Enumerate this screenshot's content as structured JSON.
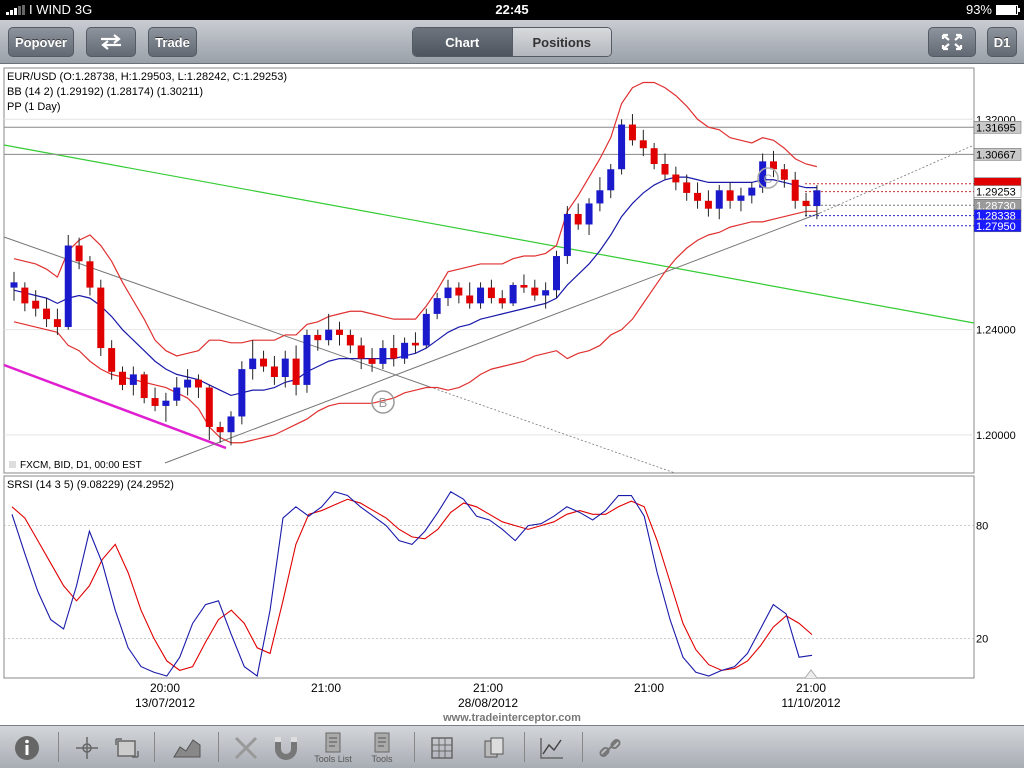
{
  "status": {
    "carrier": "I WIND",
    "network": "3G",
    "time": "22:45",
    "battery": "93%",
    "battery_level": 0.93
  },
  "toolbar": {
    "popover_label": "Popover",
    "trade_label": "Trade",
    "chart_tab": "Chart",
    "positions_tab": "Positions",
    "timeframe_label": "D1",
    "swap_icon": "swap-arrows-icon",
    "fullscreen_icon": "fullscreen-icon"
  },
  "main_chart": {
    "symbol_info": "EUR/USD (O:1.28738, H:1.29503, L:1.28242, C:1.29253)",
    "bb_info": "BB (14 2) (1.29192) (1.28174) (1.30211)",
    "pp_info": "PP (1 Day)",
    "source_info": "FXCM, BID, D1, 00:00 EST",
    "y_ticks": [
      "1.32000",
      "1.24000",
      "1.20000"
    ],
    "y_tick_values": [
      1.32,
      1.24,
      1.2
    ],
    "price_tags": [
      {
        "label": "1.31695",
        "value": 1.31695,
        "bg": "#c8c8c8",
        "fg": "#000000"
      },
      {
        "label": "1.30667",
        "value": 1.30667,
        "bg": "#c8c8c8",
        "fg": "#000000"
      },
      {
        "label": "",
        "value": 1.2955,
        "bg": "#e00000",
        "fg": "#ffffff"
      },
      {
        "label": "1.29253",
        "value": 1.29253,
        "bg": "#ffffff",
        "fg": "#000000"
      },
      {
        "label": "1.28730",
        "value": 1.2873,
        "bg": "#9a9a9a",
        "fg": "#ffffff"
      },
      {
        "label": "1.28338",
        "value": 1.28338,
        "bg": "#1a1aff",
        "fg": "#ffffff"
      },
      {
        "label": "1.27950",
        "value": 1.2795,
        "bg": "#1a1aff",
        "fg": "#ffffff"
      }
    ],
    "marker_b": "B",
    "marker_c": "C"
  },
  "sub_chart": {
    "title": "SRSI (14 3 5)  (9.08229)  (24.2952)",
    "y_ticks": [
      "80",
      "20"
    ],
    "y_tick_values": [
      80,
      20
    ]
  },
  "x_axis": {
    "times": [
      "20:00",
      "21:00",
      "21:00",
      "21:00",
      "21:00"
    ],
    "dates": [
      "13/07/2012",
      "",
      "28/08/2012",
      "",
      "11/10/2012"
    ]
  },
  "watermark": "www.tradeinterceptor.com",
  "bottom_tools": {
    "info_icon": "info-icon",
    "tools_list_label": "Tools List",
    "tools_label": "Tools"
  },
  "colors": {
    "bull": "#1a1acc",
    "bear": "#e00000",
    "bb": "#e03030",
    "mid": "#1a1aaa",
    "green_line": "#33cc33",
    "magenta_line": "#e020d0"
  },
  "chart_data": {
    "type": "candlestick",
    "symbol": "EUR/USD",
    "timeframe": "D1",
    "y_range": [
      1.1855,
      1.3395
    ],
    "candles": [
      [
        1.256,
        1.262,
        1.251,
        1.258
      ],
      [
        1.256,
        1.258,
        1.247,
        1.25
      ],
      [
        1.251,
        1.255,
        1.245,
        1.248
      ],
      [
        1.248,
        1.252,
        1.241,
        1.244
      ],
      [
        1.244,
        1.248,
        1.238,
        1.241
      ],
      [
        1.241,
        1.276,
        1.24,
        1.272
      ],
      [
        1.272,
        1.275,
        1.263,
        1.266
      ],
      [
        1.266,
        1.268,
        1.253,
        1.256
      ],
      [
        1.256,
        1.259,
        1.23,
        1.233
      ],
      [
        1.233,
        1.236,
        1.221,
        1.224
      ],
      [
        1.224,
        1.226,
        1.217,
        1.219
      ],
      [
        1.219,
        1.226,
        1.215,
        1.223
      ],
      [
        1.223,
        1.224,
        1.212,
        1.214
      ],
      [
        1.214,
        1.218,
        1.209,
        1.211
      ],
      [
        1.211,
        1.216,
        1.205,
        1.213
      ],
      [
        1.213,
        1.222,
        1.211,
        1.218
      ],
      [
        1.218,
        1.225,
        1.215,
        1.221
      ],
      [
        1.221,
        1.223,
        1.214,
        1.218
      ],
      [
        1.218,
        1.219,
        1.198,
        1.203
      ],
      [
        1.203,
        1.205,
        1.197,
        1.201
      ],
      [
        1.201,
        1.209,
        1.196,
        1.207
      ],
      [
        1.207,
        1.228,
        1.204,
        1.225
      ],
      [
        1.225,
        1.236,
        1.221,
        1.229
      ],
      [
        1.229,
        1.232,
        1.224,
        1.226
      ],
      [
        1.226,
        1.23,
        1.219,
        1.222
      ],
      [
        1.222,
        1.232,
        1.218,
        1.229
      ],
      [
        1.229,
        1.234,
        1.215,
        1.219
      ],
      [
        1.219,
        1.24,
        1.216,
        1.238
      ],
      [
        1.238,
        1.24,
        1.232,
        1.236
      ],
      [
        1.236,
        1.246,
        1.234,
        1.24
      ],
      [
        1.24,
        1.243,
        1.234,
        1.238
      ],
      [
        1.238,
        1.24,
        1.231,
        1.234
      ],
      [
        1.234,
        1.237,
        1.225,
        1.229
      ],
      [
        1.229,
        1.233,
        1.224,
        1.227
      ],
      [
        1.227,
        1.236,
        1.225,
        1.233
      ],
      [
        1.233,
        1.238,
        1.226,
        1.229
      ],
      [
        1.229,
        1.237,
        1.227,
        1.235
      ],
      [
        1.235,
        1.239,
        1.231,
        1.234
      ],
      [
        1.234,
        1.248,
        1.233,
        1.246
      ],
      [
        1.246,
        1.254,
        1.244,
        1.252
      ],
      [
        1.252,
        1.259,
        1.249,
        1.256
      ],
      [
        1.256,
        1.258,
        1.25,
        1.253
      ],
      [
        1.253,
        1.258,
        1.248,
        1.25
      ],
      [
        1.25,
        1.258,
        1.248,
        1.256
      ],
      [
        1.256,
        1.259,
        1.25,
        1.252
      ],
      [
        1.252,
        1.255,
        1.248,
        1.25
      ],
      [
        1.25,
        1.258,
        1.249,
        1.257
      ],
      [
        1.257,
        1.261,
        1.254,
        1.256
      ],
      [
        1.256,
        1.259,
        1.251,
        1.253
      ],
      [
        1.253,
        1.258,
        1.248,
        1.255
      ],
      [
        1.255,
        1.27,
        1.252,
        1.268
      ],
      [
        1.268,
        1.287,
        1.265,
        1.284
      ],
      [
        1.284,
        1.288,
        1.278,
        1.28
      ],
      [
        1.28,
        1.29,
        1.276,
        1.288
      ],
      [
        1.288,
        1.298,
        1.285,
        1.293
      ],
      [
        1.293,
        1.303,
        1.29,
        1.301
      ],
      [
        1.301,
        1.32,
        1.299,
        1.318
      ],
      [
        1.318,
        1.322,
        1.31,
        1.312
      ],
      [
        1.312,
        1.316,
        1.306,
        1.309
      ],
      [
        1.309,
        1.311,
        1.301,
        1.303
      ],
      [
        1.303,
        1.307,
        1.297,
        1.299
      ],
      [
        1.299,
        1.302,
        1.293,
        1.296
      ],
      [
        1.296,
        1.299,
        1.289,
        1.292
      ],
      [
        1.292,
        1.296,
        1.286,
        1.289
      ],
      [
        1.289,
        1.293,
        1.283,
        1.286
      ],
      [
        1.286,
        1.295,
        1.282,
        1.293
      ],
      [
        1.293,
        1.296,
        1.286,
        1.289
      ],
      [
        1.289,
        1.294,
        1.285,
        1.291
      ],
      [
        1.291,
        1.296,
        1.288,
        1.294
      ],
      [
        1.294,
        1.307,
        1.292,
        1.304
      ],
      [
        1.304,
        1.308,
        1.298,
        1.301
      ],
      [
        1.301,
        1.303,
        1.294,
        1.297
      ],
      [
        1.297,
        1.3,
        1.286,
        1.289
      ],
      [
        1.289,
        1.292,
        1.283,
        1.287
      ],
      [
        1.287,
        1.295,
        1.282,
        1.293
      ]
    ],
    "bb_upper": [
      1.267,
      1.266,
      1.265,
      1.263,
      1.26,
      1.27,
      1.274,
      1.276,
      1.272,
      1.266,
      1.258,
      1.251,
      1.244,
      1.236,
      1.232,
      1.23,
      1.231,
      1.232,
      1.236,
      1.236,
      1.235,
      1.235,
      1.236,
      1.236,
      1.236,
      1.238,
      1.238,
      1.242,
      1.243,
      1.245,
      1.246,
      1.247,
      1.247,
      1.246,
      1.245,
      1.244,
      1.244,
      1.244,
      1.249,
      1.255,
      1.262,
      1.263,
      1.264,
      1.265,
      1.265,
      1.265,
      1.267,
      1.268,
      1.268,
      1.269,
      1.272,
      1.285,
      1.291,
      1.298,
      1.305,
      1.313,
      1.326,
      1.332,
      1.334,
      1.334,
      1.332,
      1.329,
      1.325,
      1.32,
      1.317,
      1.316,
      1.313,
      1.312,
      1.311,
      1.313,
      1.312,
      1.309,
      1.305,
      1.303,
      1.302
    ],
    "bb_mid": [
      1.255,
      1.254,
      1.253,
      1.252,
      1.25,
      1.252,
      1.253,
      1.252,
      1.249,
      1.245,
      1.24,
      1.236,
      1.232,
      1.228,
      1.225,
      1.223,
      1.222,
      1.221,
      1.219,
      1.217,
      1.215,
      1.216,
      1.217,
      1.217,
      1.218,
      1.22,
      1.221,
      1.224,
      1.226,
      1.228,
      1.229,
      1.229,
      1.229,
      1.229,
      1.229,
      1.229,
      1.23,
      1.231,
      1.233,
      1.236,
      1.239,
      1.241,
      1.242,
      1.244,
      1.245,
      1.246,
      1.247,
      1.248,
      1.249,
      1.25,
      1.252,
      1.257,
      1.261,
      1.265,
      1.27,
      1.276,
      1.283,
      1.288,
      1.292,
      1.295,
      1.297,
      1.298,
      1.298,
      1.297,
      1.296,
      1.296,
      1.296,
      1.296,
      1.296,
      1.297,
      1.297,
      1.296,
      1.295,
      1.294,
      1.294
    ],
    "bb_lower": [
      1.243,
      1.242,
      1.241,
      1.24,
      1.239,
      1.234,
      1.232,
      1.228,
      1.225,
      1.223,
      1.222,
      1.221,
      1.22,
      1.219,
      1.218,
      1.216,
      1.214,
      1.21,
      1.203,
      1.199,
      1.197,
      1.197,
      1.198,
      1.199,
      1.2,
      1.202,
      1.204,
      1.206,
      1.209,
      1.211,
      1.212,
      1.212,
      1.212,
      1.212,
      1.213,
      1.214,
      1.216,
      1.217,
      1.218,
      1.218,
      1.217,
      1.218,
      1.22,
      1.223,
      1.225,
      1.226,
      1.227,
      1.228,
      1.23,
      1.231,
      1.232,
      1.229,
      1.231,
      1.232,
      1.234,
      1.238,
      1.24,
      1.244,
      1.25,
      1.256,
      1.262,
      1.267,
      1.271,
      1.274,
      1.276,
      1.277,
      1.279,
      1.28,
      1.281,
      1.281,
      1.282,
      1.283,
      1.284,
      1.285,
      1.285
    ],
    "horizontal_lines": [
      1.31695,
      1.30667,
      1.2955,
      1.2925,
      1.2873,
      1.28338,
      1.2795
    ],
    "srsi_k": [
      86,
      65,
      45,
      30,
      25,
      48,
      77,
      60,
      35,
      15,
      5,
      2,
      0,
      10,
      28,
      38,
      40,
      22,
      5,
      0,
      35,
      84,
      90,
      85,
      90,
      98,
      96,
      90,
      85,
      80,
      72,
      70,
      77,
      87,
      98,
      94,
      85,
      83,
      78,
      72,
      80,
      81,
      85,
      90,
      87,
      83,
      88,
      96,
      96,
      85,
      55,
      30,
      10,
      2,
      0,
      3,
      5,
      12,
      25,
      38,
      33,
      10,
      11
    ],
    "srsi_d": [
      90,
      84,
      72,
      60,
      48,
      40,
      48,
      62,
      70,
      55,
      35,
      20,
      8,
      3,
      5,
      18,
      30,
      35,
      28,
      15,
      12,
      40,
      70,
      86,
      88,
      91,
      94,
      92,
      88,
      84,
      78,
      74,
      73,
      78,
      87,
      92,
      90,
      86,
      82,
      80,
      78,
      80,
      82,
      86,
      88,
      86,
      86,
      90,
      93,
      90,
      72,
      50,
      28,
      14,
      6,
      3,
      4,
      8,
      16,
      26,
      32,
      28,
      22
    ]
  }
}
